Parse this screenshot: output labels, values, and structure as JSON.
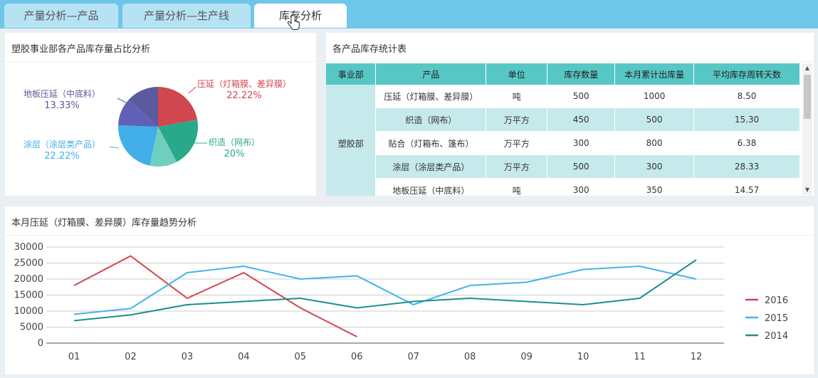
{
  "tabs": [
    {
      "label": "产量分析—产品"
    },
    {
      "label": "产量分析—生产线"
    },
    {
      "label": "库存分析"
    }
  ],
  "colors": {
    "accent": "#6ec6e8",
    "teal_header": "#56c7c4",
    "row_alt": "#c6e9ec"
  },
  "pie_panel": {
    "title": "塑胶事业部各产品库存量占比分析"
  },
  "table_panel": {
    "title": "各产品库存统计表",
    "columns": [
      "事业部",
      "产品",
      "单位",
      "库存数量",
      "本月累计出库量",
      "平均库存周转天数"
    ],
    "department": "塑胶部",
    "rows": [
      {
        "product": "压延（灯箱膜、差异膜）",
        "unit": "吨",
        "stock": "500",
        "outbound": "1000",
        "turnover": "8.50"
      },
      {
        "product": "织造（网布）",
        "unit": "万平方",
        "stock": "450",
        "outbound": "500",
        "turnover": "15.30"
      },
      {
        "product": "贴合（灯箱布、篷布）",
        "unit": "万平方",
        "stock": "300",
        "outbound": "800",
        "turnover": "6.38"
      },
      {
        "product": "涂层（涂层类产品）",
        "unit": "万平方",
        "stock": "500",
        "outbound": "300",
        "turnover": "28.33"
      },
      {
        "product": "地板压延（中底料）",
        "unit": "吨",
        "stock": "300",
        "outbound": "350",
        "turnover": "14.57"
      }
    ]
  },
  "line_panel": {
    "title": "本月压延（灯箱膜、差异膜）库存量趋势分析"
  },
  "chart_data": [
    {
      "type": "pie",
      "title": "塑胶事业部各产品库存量占比分析",
      "slices": [
        {
          "label": "压延（灯箱膜、差异膜）",
          "value": 22.22,
          "value_label": "22.22%",
          "color": "#d1474f"
        },
        {
          "label": "织造（网布）",
          "value": 20,
          "value_label": "20%",
          "color": "#2aa88a"
        },
        {
          "label": "",
          "value": 11.11,
          "value_label": "",
          "color": "#6fcfbf"
        },
        {
          "label": "涂层（涂层类产品）",
          "value": 22.22,
          "value_label": "22.22%",
          "color": "#42aee8"
        },
        {
          "label": "",
          "value": 11.11,
          "value_label": "",
          "color": "#6060b6"
        },
        {
          "label": "地板压延（中底料）",
          "value": 13.33,
          "value_label": "13.33%",
          "color": "#5a5a9e"
        }
      ]
    },
    {
      "type": "line",
      "title": "本月压延（灯箱膜、差异膜）库存量趋势分析",
      "categories": [
        "01",
        "02",
        "03",
        "04",
        "05",
        "06",
        "07",
        "08",
        "09",
        "10",
        "11",
        "12"
      ],
      "ylim": [
        0,
        30000
      ],
      "yticks": [
        "0",
        "5000",
        "10000",
        "15000",
        "20000",
        "25000",
        "30000"
      ],
      "legend_position": "right",
      "grid": true,
      "series": [
        {
          "name": "2016",
          "color": "#d1474f",
          "values": [
            18000,
            27200,
            14000,
            22000,
            11000,
            2000,
            null,
            null,
            null,
            null,
            null,
            null
          ]
        },
        {
          "name": "2015",
          "color": "#42b4ec",
          "values": [
            9000,
            10800,
            22000,
            24000,
            20000,
            21000,
            12000,
            18000,
            19000,
            23000,
            24000,
            20000
          ]
        },
        {
          "name": "2014",
          "color": "#1d8f8c",
          "values": [
            7000,
            8800,
            12000,
            13000,
            14000,
            11000,
            13000,
            14000,
            13000,
            12000,
            14000,
            26000
          ]
        }
      ]
    }
  ]
}
